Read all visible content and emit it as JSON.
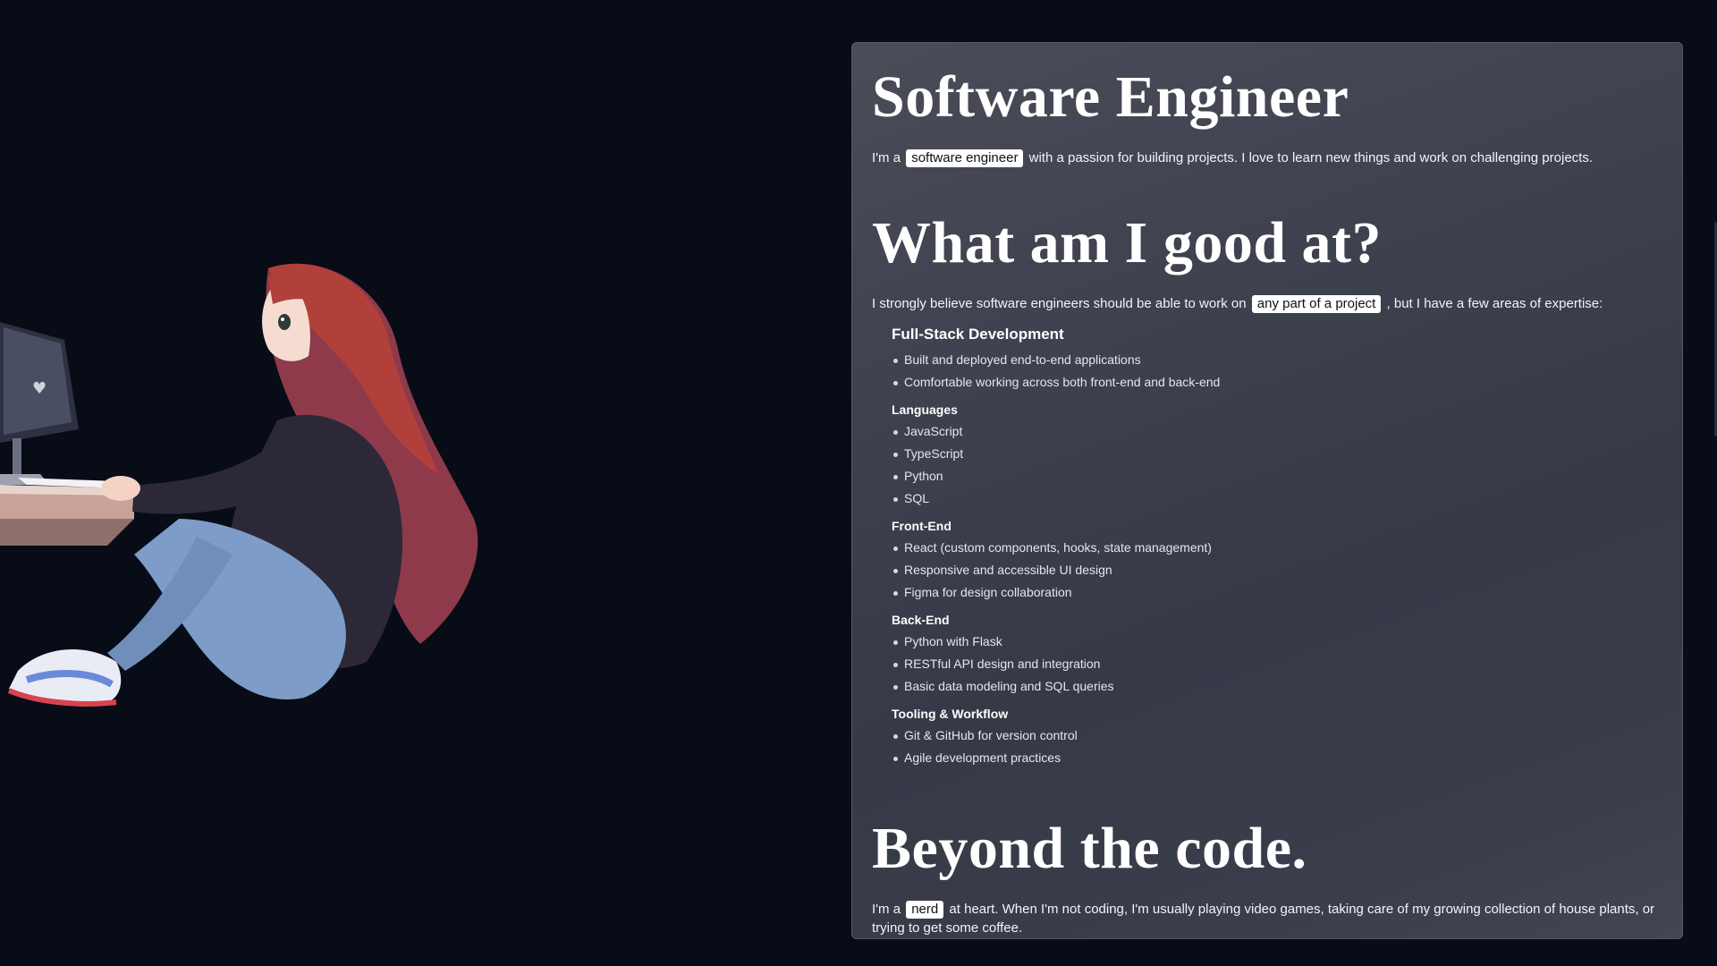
{
  "hero": {
    "title": "Software Engineer",
    "intro_before": "I'm a",
    "intro_highlight": "software engineer",
    "intro_after": "with a passion for building projects. I love to learn new things and work on challenging projects."
  },
  "skills": {
    "title": "What am I good at?",
    "intro_before": "I strongly believe software engineers should be able to work on",
    "intro_highlight": "any part of a project",
    "intro_after": ", but I have a few areas of expertise:",
    "groups": [
      {
        "title": "Full-Stack Development",
        "items": [
          "Built and deployed end-to-end applications",
          "Comfortable working across both front-end and back-end"
        ]
      },
      {
        "title": "Languages",
        "items": [
          "JavaScript",
          "TypeScript",
          "Python",
          "SQL"
        ]
      },
      {
        "title": "Front-End",
        "items": [
          "React (custom components, hooks, state management)",
          "Responsive and accessible UI design",
          "Figma for design collaboration"
        ]
      },
      {
        "title": "Back-End",
        "items": [
          "Python with Flask",
          "RESTful API design and integration",
          "Basic data modeling and SQL queries"
        ]
      },
      {
        "title": "Tooling & Workflow",
        "items": [
          "Git & GitHub for version control",
          "Agile development practices"
        ]
      }
    ]
  },
  "beyond": {
    "title": "Beyond the code.",
    "text_before": "I'm a",
    "text_highlight": "nerd",
    "text_after": "at heart. When I'm not coding, I'm usually playing video games, taking care of my growing collection of house plants, or trying to get some coffee."
  },
  "colors": {
    "background": "#070c16",
    "card": "#3d404d",
    "highlight": "#ffffff",
    "hair": "#b2403a",
    "hoodie": "#2c2838",
    "jeans": "#7d9dc8"
  }
}
